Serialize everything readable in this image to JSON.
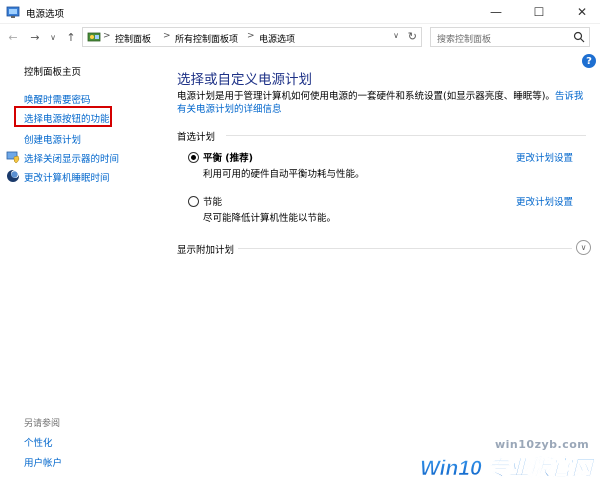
{
  "window": {
    "title": "电源选项",
    "minimize": "—",
    "maximize": "☐",
    "close": "✕"
  },
  "nav": {
    "back": "←",
    "forward": "→",
    "dropdown": "∨",
    "up": "↑",
    "breadcrumbs": [
      "控制面板",
      "所有控制面板项",
      "电源选项"
    ],
    "separator": ">",
    "refresh": "↻",
    "search_placeholder": "搜索控制面板"
  },
  "sidebar": {
    "items": [
      {
        "label": "控制面板主页"
      },
      {
        "label": "唤醒时需要密码"
      },
      {
        "label": "选择电源按钮的功能"
      },
      {
        "label": "创建电源计划"
      },
      {
        "label": "选择关闭显示器的时间"
      },
      {
        "label": "更改计算机睡眠时间"
      }
    ],
    "see_also_title": "另请参阅",
    "see_also": [
      {
        "label": "个性化"
      },
      {
        "label": "用户帐户"
      }
    ]
  },
  "main": {
    "help": "?",
    "title": "选择或自定义电源计划",
    "description": "电源计划是用于管理计算机如何使用电源的一套硬件和系统设置(如显示器亮度、睡眠等)。",
    "description_link": "告诉我有关电源计划的详细信息",
    "preferred_label": "首选计划",
    "plans": [
      {
        "name": "平衡 (推荐)",
        "desc": "利用可用的硬件自动平衡功耗与性能。",
        "link": "更改计划设置",
        "selected": true
      },
      {
        "name": "节能",
        "desc": "尽可能降低计算机性能以节能。",
        "link": "更改计划设置",
        "selected": false
      }
    ],
    "extra_label": "显示附加计划",
    "expand": "∨"
  },
  "watermark": {
    "url": "win10zyb.com",
    "logo_text": "Win10 专业版官网"
  },
  "colors": {
    "link": "#0066cc",
    "title": "#1e3287",
    "highlight": "#d40000"
  }
}
